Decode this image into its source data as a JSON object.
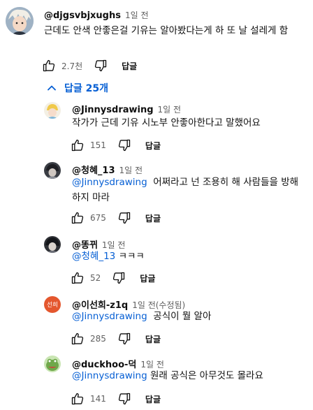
{
  "main_comment": {
    "handle": "@djgsvbjxughs",
    "time": "1일 전",
    "text": "근데도 안색 안좋은걸 기유는 알아봤다는게 하 또 날 설레게 함",
    "likes": "2.7천",
    "reply_label": "답글"
  },
  "replies_toggle": {
    "label": "답글 25개"
  },
  "replies": [
    {
      "handle": "@Jinnysdrawing",
      "time": "1일 전",
      "mention": "",
      "text": "작가가 근데 기유 시노부 안좋아한다고 말했어요",
      "likes": "151",
      "reply_label": "답글"
    },
    {
      "handle": "@청혜_13",
      "time": "1일 전",
      "mention": "@Jinnysdrawing",
      "text": "어쩌라고 넌 조용히 해 사람들을 방해하지 마라",
      "likes": "675",
      "reply_label": "답글"
    },
    {
      "handle": "@똥뀌",
      "time": "1일 전",
      "mention": "@청혜_13",
      "text": "ㅋㅋㅋ",
      "likes": "52",
      "reply_label": "답글"
    },
    {
      "handle": "@이선희-z1q",
      "time": "1일 전(수정됨)",
      "avatar_text": "선희",
      "mention": "@Jinnysdrawing",
      "text": "공식이 뭘 알아",
      "likes": "285",
      "reply_label": "답글"
    },
    {
      "handle": "@duckhoo-덕",
      "time": "1일 전",
      "mention": "@Jinnysdrawing",
      "text": "원래 공식은 아무것도 몰라요",
      "likes": "141",
      "reply_label": "답글"
    }
  ],
  "colors": {
    "link": "#065fd4",
    "secondary": "#606060",
    "avatar_orange": "#e4572e"
  }
}
